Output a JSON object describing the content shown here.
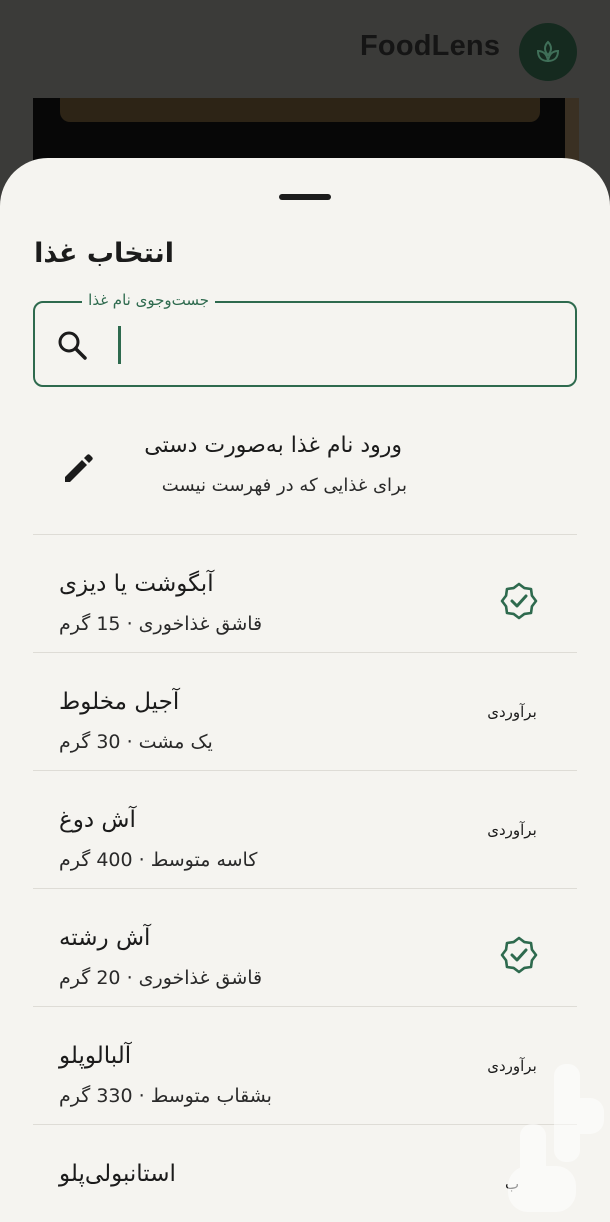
{
  "app": {
    "title": "FoodLens",
    "logo_icon": "leaf-icon",
    "brand_color": "#152a1f"
  },
  "sheet": {
    "title": "انتخاب غذا",
    "search": {
      "label": "جست‌وجوی نام غذا",
      "placeholder": "",
      "value": "",
      "icon": "search-icon"
    },
    "manual_entry": {
      "icon": "pencil-icon",
      "title": "ورود نام غذا به‌صورت دستی",
      "subtitle": "برای غذایی که در فهرست نیست"
    },
    "foods": [
      {
        "name": "آبگوشت یا دیزی",
        "serving": "قاشق غذاخوری · 15 گرم",
        "status": "verified"
      },
      {
        "name": "آجیل مخلوط",
        "serving": "یک مشت · 30 گرم",
        "status": "estimated",
        "status_label": "برآوردی"
      },
      {
        "name": "آش دوغ",
        "serving": "کاسه متوسط · 400 گرم",
        "status": "estimated",
        "status_label": "برآوردی"
      },
      {
        "name": "آش رشته",
        "serving": "قاشق غذاخوری · 20 گرم",
        "status": "verified"
      },
      {
        "name": "آلبالوپلو",
        "serving": "بشقاب متوسط · 330 گرم",
        "status": "estimated",
        "status_label": "برآوردی"
      },
      {
        "name": "استانبولی‌پلو",
        "serving": "",
        "status": "estimated",
        "status_label": "ب"
      }
    ],
    "accent_color": "#2e6a4e"
  }
}
